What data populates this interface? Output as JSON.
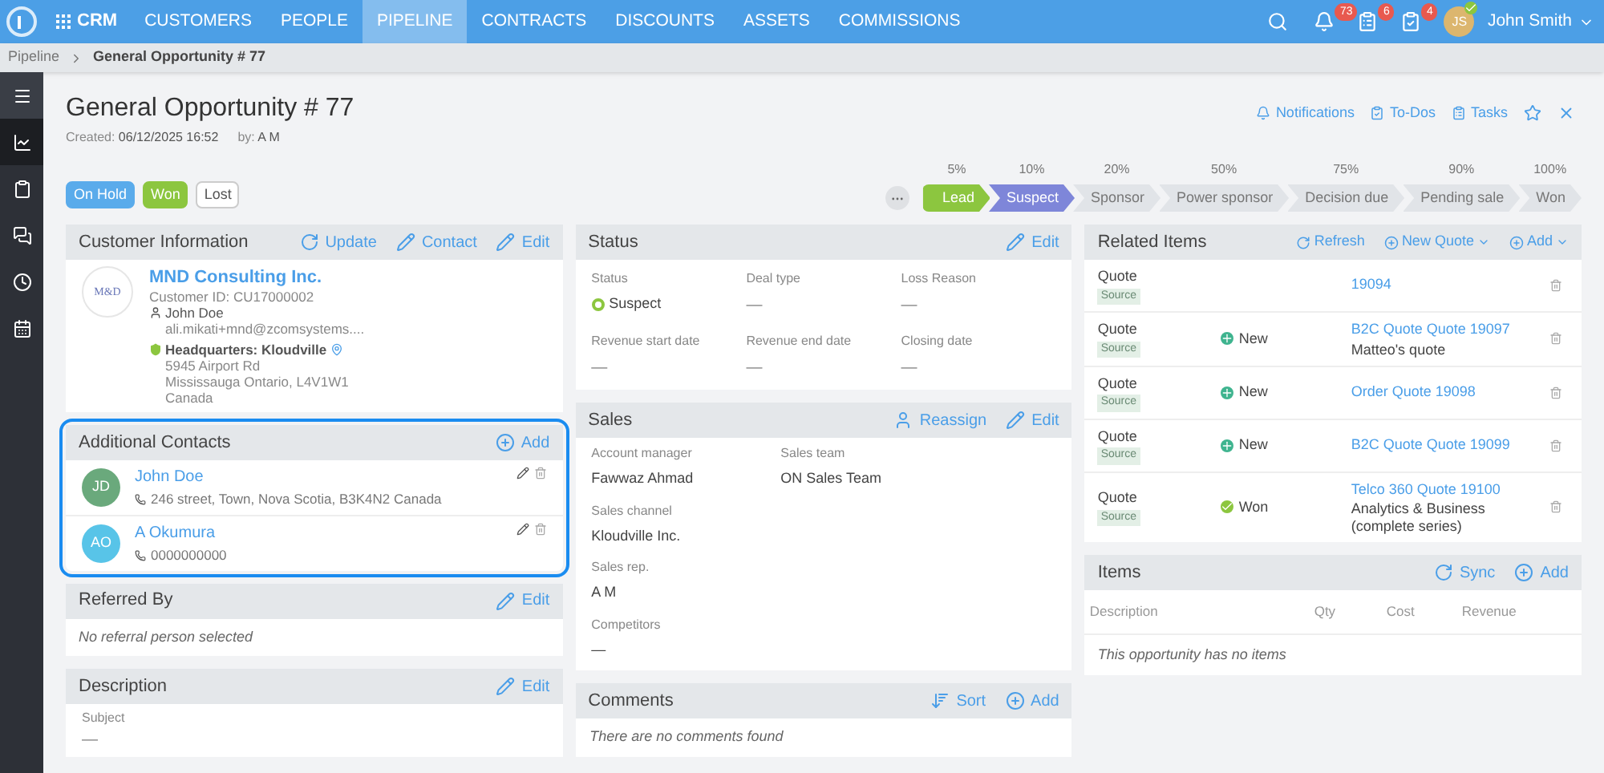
{
  "topnav": {
    "brand": "CRM",
    "items": [
      {
        "label": "CUSTOMERS",
        "selected": false
      },
      {
        "label": "PEOPLE",
        "selected": false
      },
      {
        "label": "PIPELINE",
        "selected": true
      },
      {
        "label": "CONTRACTS",
        "selected": false
      },
      {
        "label": "DISCOUNTS",
        "selected": false
      },
      {
        "label": "ASSETS",
        "selected": false
      },
      {
        "label": "COMMISSIONS",
        "selected": false
      }
    ],
    "badges": [
      {
        "kind": "bell",
        "count": "73"
      },
      {
        "kind": "timer",
        "count": "6"
      },
      {
        "kind": "tasks",
        "count": "4"
      }
    ],
    "user": {
      "initials": "JS",
      "name": "John Smith"
    }
  },
  "breadcrumb": [
    "Pipeline",
    "General Opportunity # 77"
  ],
  "sidebar": [
    {
      "kind": "menu",
      "selected": false
    },
    {
      "kind": "chart",
      "selected": true
    },
    {
      "kind": "clipboard",
      "selected": false
    },
    {
      "kind": "chat",
      "selected": false
    },
    {
      "kind": "clock",
      "selected": false
    },
    {
      "kind": "calendar",
      "selected": false
    }
  ],
  "header": {
    "title": "General Opportunity # 77",
    "created_label": "Created:",
    "created": "06/12/2025 16:52",
    "by_label": "by:",
    "by": "A M",
    "actions": [
      {
        "kind": "bell",
        "label": "Notifications"
      },
      {
        "kind": "todo",
        "label": "To-Dos"
      },
      {
        "kind": "tasks",
        "label": "Tasks"
      }
    ]
  },
  "status_buttons": [
    {
      "kind": "hold",
      "label": "On Hold"
    },
    {
      "kind": "won",
      "label": "Won"
    },
    {
      "kind": "lost",
      "label": "Lost"
    }
  ],
  "pipeline": [
    {
      "percent": "5%",
      "label": "Lead",
      "selected": false
    },
    {
      "percent": "10%",
      "label": "Suspect",
      "selected": true
    },
    {
      "percent": "20%",
      "label": "Sponsor",
      "selected": false
    },
    {
      "percent": "50%",
      "label": "Power sponsor",
      "selected": false
    },
    {
      "percent": "75%",
      "label": "Decision due",
      "selected": false
    },
    {
      "percent": "90%",
      "label": "Pending sale",
      "selected": false
    },
    {
      "percent": "100%",
      "label": "Won",
      "selected": false
    }
  ],
  "customer": {
    "title": "Customer Information",
    "actions": [
      {
        "kind": "refresh",
        "label": "Update"
      },
      {
        "kind": "edit",
        "label": "Contact"
      },
      {
        "kind": "edit",
        "label": "Edit"
      }
    ],
    "logo": "M&D",
    "name": "MND Consulting Inc.",
    "id_label": "Customer ID:",
    "id": "CU17000002",
    "contact": "John Doe",
    "email": "ali.mikati+mnd@zcomsystems....",
    "location": "Headquarters: Kloudville",
    "address": [
      "5945 Airport Rd",
      "Mississauga Ontario, L4V1W1",
      "Canada"
    ]
  },
  "contacts": {
    "title": "Additional Contacts",
    "highlighted": true,
    "add": "Add",
    "items": [
      {
        "initials": "JD",
        "color": "#6aa97c",
        "name": "John Doe",
        "phone": "246 street, Town, Nova Scotia, B3K4N2 Canada"
      },
      {
        "initials": "AO",
        "color": "#58c4e8",
        "name": "A Okumura",
        "phone": "0000000000"
      }
    ]
  },
  "referred": {
    "title": "Referred By",
    "edit": "Edit",
    "empty": "No referral person selected"
  },
  "description": {
    "title": "Description",
    "edit": "Edit",
    "field": "Subject",
    "value": "—"
  },
  "status": {
    "title": "Status",
    "edit": "Edit",
    "fields": [
      {
        "label": "Status",
        "value": "Suspect",
        "kind": "status"
      },
      {
        "label": "Deal type",
        "value": "—"
      },
      {
        "label": "Loss Reason",
        "value": "—"
      },
      {
        "label": "Revenue start date",
        "value": "—"
      },
      {
        "label": "Revenue end date",
        "value": "—"
      },
      {
        "label": "Closing date",
        "value": "—"
      }
    ]
  },
  "sales": {
    "title": "Sales",
    "reassign": "Reassign",
    "edit": "Edit",
    "rows": [
      [
        {
          "label": "Account manager",
          "value": "Fawwaz Ahmad"
        },
        {
          "label": "Sales team",
          "value": "ON Sales Team"
        }
      ],
      [
        {
          "label": "Sales channel",
          "value": "Kloudville Inc."
        }
      ],
      [
        {
          "label": "Sales rep.",
          "value": "A M"
        }
      ],
      [
        {
          "label": "Competitors",
          "value": "—"
        }
      ]
    ]
  },
  "comments": {
    "title": "Comments",
    "sort": "Sort",
    "add": "Add",
    "empty": "There are no comments found"
  },
  "related": {
    "title": "Related Items",
    "actions": [
      {
        "kind": "refresh",
        "label": "Refresh",
        "caret": false
      },
      {
        "kind": "add",
        "label": "New Quote",
        "caret": true
      },
      {
        "kind": "add",
        "label": "Add",
        "caret": true
      }
    ],
    "rows": [
      {
        "type": "Quote",
        "tag": "Source",
        "link": "19094"
      },
      {
        "type": "Quote",
        "tag": "Source",
        "status": {
          "kind": "new",
          "label": "New"
        },
        "link": "B2C Quote Quote 19097",
        "note": "Matteo's quote"
      },
      {
        "type": "Quote",
        "tag": "Source",
        "status": {
          "kind": "new",
          "label": "New"
        },
        "link": "Order Quote 19098"
      },
      {
        "type": "Quote",
        "tag": "Source",
        "status": {
          "kind": "new",
          "label": "New"
        },
        "link": "B2C Quote Quote 19099"
      },
      {
        "type": "Quote",
        "tag": "Source",
        "status": {
          "kind": "won",
          "label": "Won"
        },
        "link": "Telco 360 Quote 19100",
        "note": "Analytics & Business (complete series)"
      }
    ]
  },
  "items": {
    "title": "Items",
    "sync": "Sync",
    "add": "Add",
    "columns": [
      "Description",
      "Qty",
      "Cost",
      "Revenue"
    ],
    "empty": "This opportunity has no items"
  }
}
